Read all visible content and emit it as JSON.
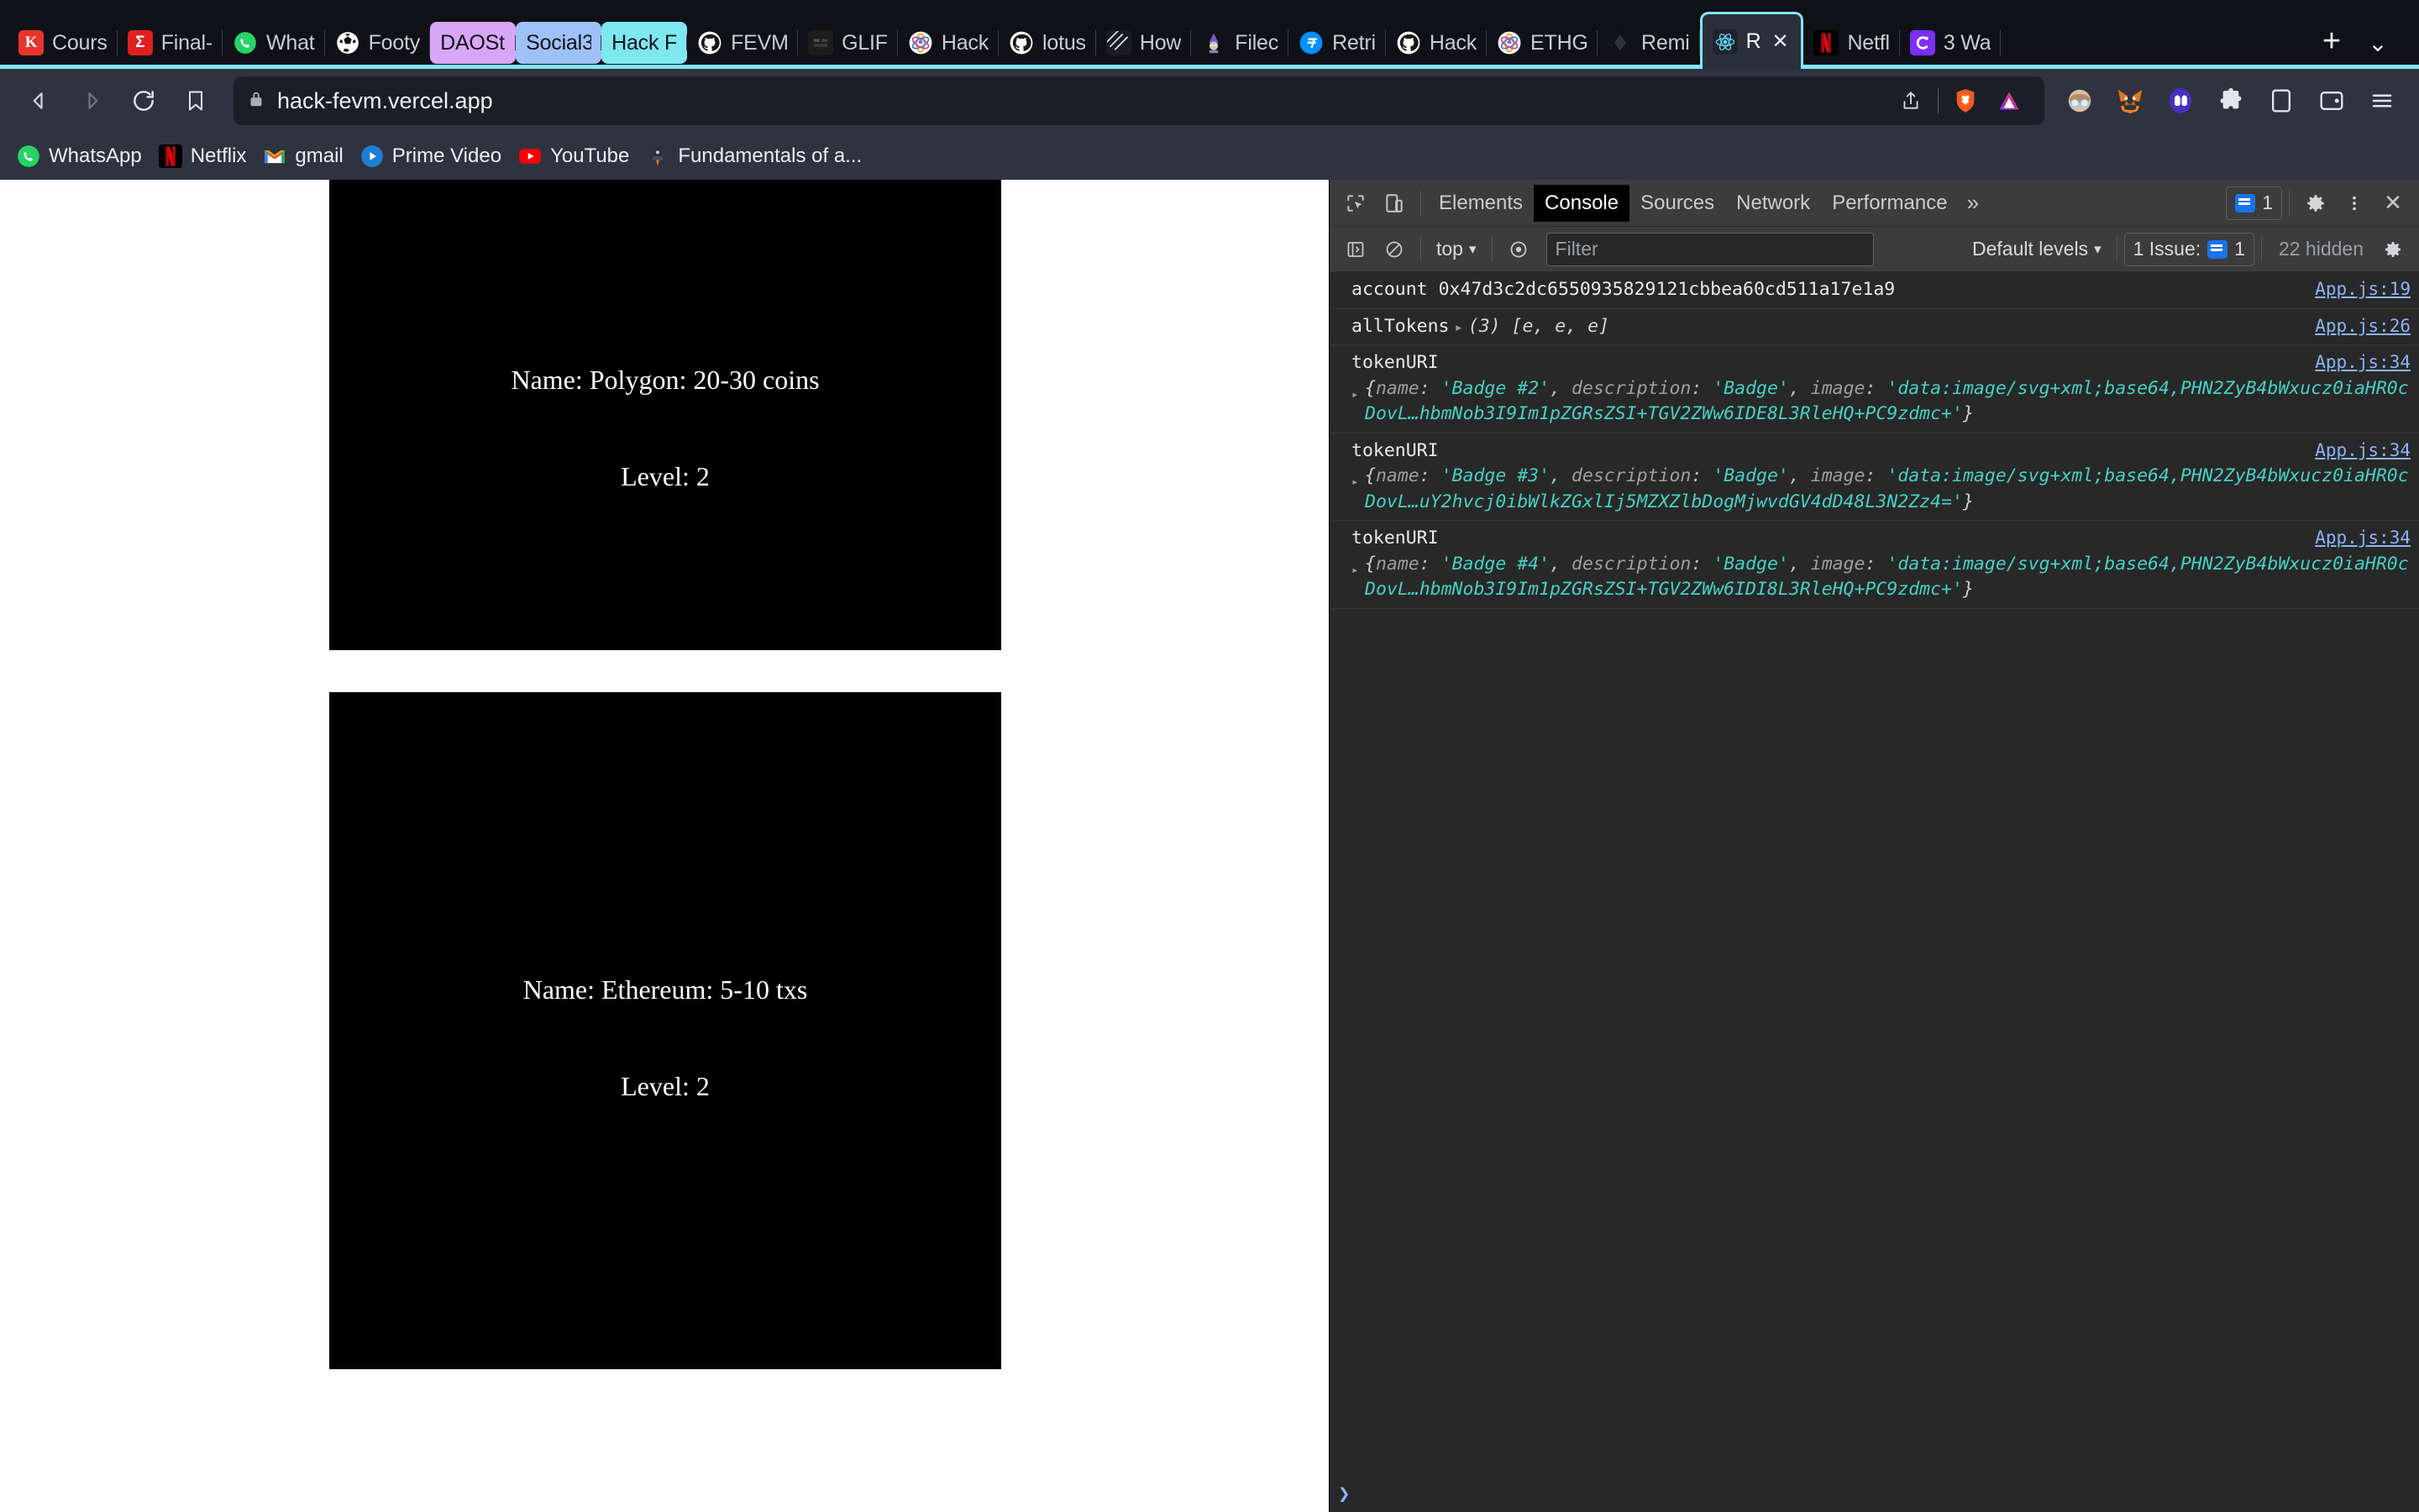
{
  "browser": {
    "name": "Brave",
    "tabstrip": {
      "accent_color": "#7fe7ef",
      "new_tab_label": "+",
      "tab_list_chevron": "⌄",
      "tabs": [
        {
          "label": "Cours",
          "icon": "kaggle-icon",
          "favicon_bg": "#e8342a",
          "favicon_text": "K",
          "pill": "",
          "active": false
        },
        {
          "label": "Final-",
          "icon": "sigma-icon",
          "favicon_bg": "#e02020",
          "favicon_text": "Σ",
          "pill": "",
          "active": false
        },
        {
          "label": "What",
          "icon": "whatsapp-icon",
          "favicon_bg": "#25d366",
          "favicon_text": "",
          "pill": "",
          "active": false
        },
        {
          "label": "Footy",
          "icon": "football-icon",
          "favicon_bg": "#0b1e4d",
          "favicon_text": "",
          "pill": "",
          "active": false
        },
        {
          "label": "DAOStruct",
          "icon": "none",
          "favicon_bg": "",
          "favicon_text": "",
          "pill": "#d9a6f7",
          "active": false
        },
        {
          "label": "Social3",
          "icon": "none",
          "favicon_bg": "",
          "favicon_text": "",
          "pill": "#9ec1f7",
          "active": false
        },
        {
          "label": "Hack FEVM",
          "icon": "none",
          "favicon_bg": "",
          "favicon_text": "",
          "pill": "#7fe7ef",
          "active": false
        },
        {
          "label": "FEVM",
          "icon": "github-icon",
          "favicon_bg": "#ffffff",
          "favicon_text": "",
          "pill": "",
          "active": false
        },
        {
          "label": "GLIF",
          "icon": "glif-icon",
          "favicon_bg": "#1d1d1d",
          "favicon_text": "",
          "pill": "",
          "active": false
        },
        {
          "label": "Hack",
          "icon": "ethglobal-icon",
          "favicon_bg": "#ffffff",
          "favicon_text": "",
          "pill": "",
          "active": false
        },
        {
          "label": "lotus",
          "icon": "github-icon",
          "favicon_bg": "#ffffff",
          "favicon_text": "",
          "pill": "",
          "active": false
        },
        {
          "label": "How",
          "icon": "stripes-icon",
          "favicon_bg": "#1a1c22",
          "favicon_text": "",
          "pill": "",
          "active": false
        },
        {
          "label": "Filec",
          "icon": "wizard-icon",
          "favicon_bg": "#1a1c22",
          "favicon_text": "",
          "pill": "",
          "active": false
        },
        {
          "label": "Retri",
          "icon": "filecoin-icon",
          "favicon_bg": "#0090ff",
          "favicon_text": "",
          "pill": "",
          "active": false
        },
        {
          "label": "Hack",
          "icon": "github-icon",
          "favicon_bg": "#ffffff",
          "favicon_text": "",
          "pill": "",
          "active": false
        },
        {
          "label": "ETHG",
          "icon": "ethglobal-icon",
          "favicon_bg": "#ffffff",
          "favicon_text": "",
          "pill": "",
          "active": false
        },
        {
          "label": "Remi",
          "icon": "remix-icon",
          "favicon_bg": "#12131a",
          "favicon_text": "",
          "pill": "",
          "active": false
        },
        {
          "label": "R",
          "icon": "react-icon",
          "favicon_bg": "#20232a",
          "favicon_text": "",
          "pill": "",
          "active": true,
          "close_label": "✕"
        },
        {
          "label": "Netfl",
          "icon": "netflix-icon",
          "favicon_bg": "#000000",
          "favicon_text": "N",
          "pill": "",
          "active": false
        },
        {
          "label": "3 Wa",
          "icon": "c-purple-icon",
          "favicon_bg": "#7b2ff7",
          "favicon_text": "C",
          "pill": "",
          "active": false
        }
      ]
    },
    "navbar": {
      "back_label": "Back",
      "forward_label": "Forward",
      "reload_label": "Reload",
      "bookmark_label": "Bookmark this page",
      "url": "hack-fevm.vercel.app",
      "lock_label": "View site information",
      "share_label": "Share",
      "shields_label": "Brave Shields",
      "rewards_label": "Brave Rewards",
      "profile_label": "Profile",
      "metamask_label": "MetaMask",
      "phantom_label": "Phantom",
      "extensions_label": "Extensions",
      "sidebar_label": "Show sidebar",
      "wallet_label": "Brave Wallet",
      "menu_label": "Customize and control Brave"
    },
    "bookmarks": [
      {
        "label": "WhatsApp",
        "icon": "whatsapp-icon"
      },
      {
        "label": "Netflix",
        "icon": "netflix-icon"
      },
      {
        "label": "gmail",
        "icon": "gmail-icon"
      },
      {
        "label": "Prime Video",
        "icon": "prime-video-icon"
      },
      {
        "label": "YouTube",
        "icon": "youtube-icon"
      },
      {
        "label": "Fundamentals of a...",
        "icon": "rocket-icon"
      }
    ]
  },
  "page": {
    "nfts": [
      {
        "name_line": "Name: Polygon: 20-30 coins",
        "level_line": "Level: 2"
      },
      {
        "name_line": "Name: Ethereum: 5-10 txs",
        "level_line": "Level: 2"
      }
    ]
  },
  "devtools": {
    "toolbar": {
      "inspect_label": "Inspect element",
      "device_label": "Toggle device toolbar",
      "tabs": [
        {
          "label": "Elements",
          "active": false
        },
        {
          "label": "Console",
          "active": true
        },
        {
          "label": "Sources",
          "active": false
        },
        {
          "label": "Network",
          "active": false
        },
        {
          "label": "Performance",
          "active": false
        }
      ],
      "more_tabs_label": "»",
      "issues_count": "1",
      "settings_label": "Settings",
      "kebab_label": "More options",
      "close_label": "✕"
    },
    "filterbar": {
      "sidebar_toggle_label": "Show console sidebar",
      "clear_label": "Clear console",
      "context": "top",
      "context_caret": "▾",
      "eye_label": "Create live expression",
      "filter_placeholder": "Filter",
      "filter_value": "",
      "levels_label": "Default levels",
      "levels_caret": "▾",
      "issues_label": "1 Issue:",
      "issues_count": "1",
      "hidden_label": "22 hidden",
      "settings_label": "Console settings"
    },
    "messages": [
      {
        "type": "simple",
        "label": "account",
        "value": "0x47d3c2dc6550935829121cbbea60cd511a17e1a9",
        "source": "App.js:19"
      },
      {
        "type": "array",
        "label": "allTokens",
        "triangle": "▸",
        "value": "(3) [e, e, e]",
        "source": "App.js:26"
      },
      {
        "type": "object",
        "label": "tokenURI",
        "source": "App.js:34",
        "triangle": "▸",
        "object_prefix": "{",
        "keys": [
          "name",
          "description",
          "image"
        ],
        "name_value": "'Badge #2'",
        "description_value": "'Badge'",
        "image_value": "'data:image/svg+xml;base64,PHN2ZyB4bWxucz0iaHR0cDovL…hbmNob3I9Im1pZGRsZSI+TGV2ZWw6IDE8L3RleHQ+PC9zdmc+'",
        "object_suffix": "}"
      },
      {
        "type": "object",
        "label": "tokenURI",
        "source": "App.js:34",
        "triangle": "▸",
        "object_prefix": "{",
        "keys": [
          "name",
          "description",
          "image"
        ],
        "name_value": "'Badge #3'",
        "description_value": "'Badge'",
        "image_value": "'data:image/svg+xml;base64,PHN2ZyB4bWxucz0iaHR0cDovL…uY2hvcj0ibWlkZGxlIj5MZXZlbDogMjwvdGV4dD48L3N2Zz4='",
        "object_suffix": "}"
      },
      {
        "type": "object",
        "label": "tokenURI",
        "source": "App.js:34",
        "triangle": "▸",
        "object_prefix": "{",
        "keys": [
          "name",
          "description",
          "image"
        ],
        "name_value": "'Badge #4'",
        "description_value": "'Badge'",
        "image_value": "'data:image/svg+xml;base64,PHN2ZyB4bWxucz0iaHR0cDovL…hbmNob3I9Im1pZGRsZSI+TGV2ZWw6IDI8L3RleHQ+PC9zdmc+'",
        "object_suffix": "}"
      }
    ],
    "prompt": {
      "caret": "❯",
      "value": ""
    }
  }
}
